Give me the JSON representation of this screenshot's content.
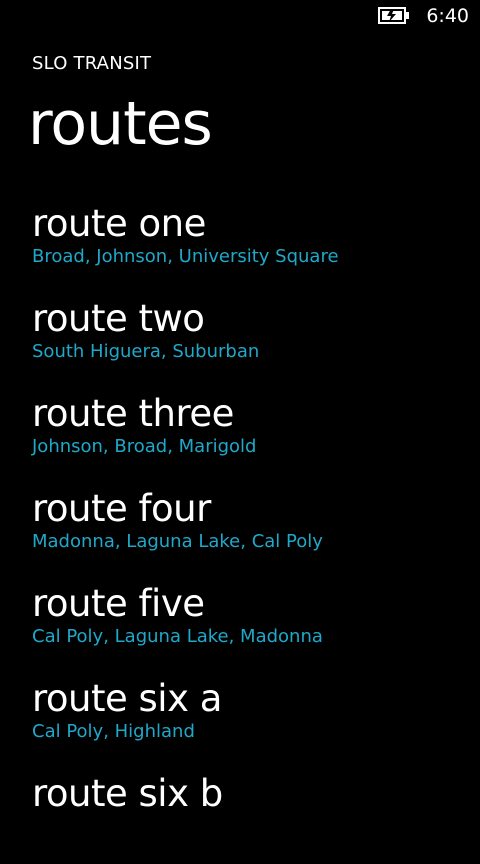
{
  "status_bar": {
    "time": "6:40",
    "battery_icon": "battery-charging-icon"
  },
  "app": {
    "title": "SLO TRANSIT"
  },
  "page": {
    "title": "routes"
  },
  "colors": {
    "background": "#000000",
    "text": "#ffffff",
    "accent": "#1fa8c9"
  },
  "routes": [
    {
      "name": "route one",
      "stops": "Broad, Johnson, University Square"
    },
    {
      "name": "route two",
      "stops": "South Higuera, Suburban"
    },
    {
      "name": "route three",
      "stops": "Johnson, Broad, Marigold"
    },
    {
      "name": "route four",
      "stops": "Madonna, Laguna Lake, Cal Poly"
    },
    {
      "name": "route five",
      "stops": "Cal Poly, Laguna Lake, Madonna"
    },
    {
      "name": "route six a",
      "stops": "Cal Poly, Highland"
    },
    {
      "name": "route six b",
      "stops": ""
    }
  ]
}
